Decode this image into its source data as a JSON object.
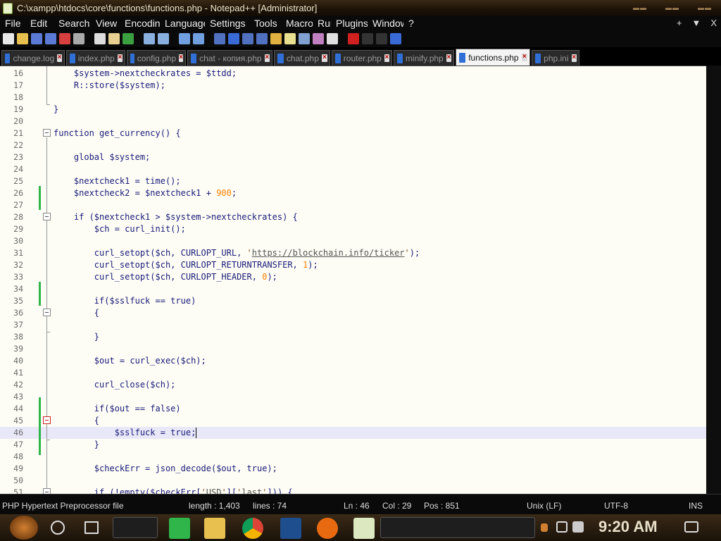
{
  "window": {
    "title": "C:\\xampp\\htdocs\\core\\functions\\functions.php - Notepad++ [Administrator]",
    "controls": [
      "minimize",
      "maximize",
      "close"
    ]
  },
  "menu": {
    "items": [
      "File",
      "Edit",
      "Search",
      "View",
      "Encoding",
      "Language",
      "Settings",
      "Tools",
      "Macro",
      "Run",
      "Plugins",
      "Window",
      "?"
    ],
    "right": [
      "+",
      "▼",
      "X"
    ]
  },
  "tabs": [
    {
      "label": "change.log",
      "active": false
    },
    {
      "label": "index.php",
      "active": false
    },
    {
      "label": "config.php",
      "active": false
    },
    {
      "label": "chat - копия.php",
      "active": false
    },
    {
      "label": "chat.php",
      "active": false
    },
    {
      "label": "router.php",
      "active": false
    },
    {
      "label": "minify.php",
      "active": false
    },
    {
      "label": "functions.php",
      "active": true
    },
    {
      "label": "php.ini",
      "active": false
    }
  ],
  "code": {
    "lines": [
      {
        "n": "16",
        "text": "    $system->nextcheckrates = $ttdd;"
      },
      {
        "n": "17",
        "text": "    R::store($system);"
      },
      {
        "n": "18",
        "text": ""
      },
      {
        "n": "19",
        "text": "}"
      },
      {
        "n": "20",
        "text": ""
      },
      {
        "n": "21",
        "text": "function get_currency() {"
      },
      {
        "n": "22",
        "text": ""
      },
      {
        "n": "23",
        "text": "    global $system;"
      },
      {
        "n": "24",
        "text": ""
      },
      {
        "n": "25",
        "text": "    $nextcheck1 = time();"
      },
      {
        "n": "26",
        "text": "    $nextcheck2 = $nextcheck1 + 900;"
      },
      {
        "n": "27",
        "text": ""
      },
      {
        "n": "28",
        "text": "    if ($nextcheck1 > $system->nextcheckrates) {"
      },
      {
        "n": "29",
        "text": "        $ch = curl_init();"
      },
      {
        "n": "30",
        "text": ""
      },
      {
        "n": "31",
        "text": "        curl_setopt($ch, CURLOPT_URL, 'https://blockchain.info/ticker');"
      },
      {
        "n": "32",
        "text": "        curl_setopt($ch, CURLOPT_RETURNTRANSFER, 1);"
      },
      {
        "n": "33",
        "text": "        curl_setopt($ch, CURLOPT_HEADER, 0);"
      },
      {
        "n": "34",
        "text": ""
      },
      {
        "n": "35",
        "text": "        if($sslfuck == true)"
      },
      {
        "n": "36",
        "text": "        {"
      },
      {
        "n": "37",
        "text": ""
      },
      {
        "n": "38",
        "text": "        }"
      },
      {
        "n": "39",
        "text": ""
      },
      {
        "n": "40",
        "text": "        $out = curl_exec($ch);"
      },
      {
        "n": "41",
        "text": ""
      },
      {
        "n": "42",
        "text": "        curl_close($ch);"
      },
      {
        "n": "43",
        "text": ""
      },
      {
        "n": "44",
        "text": "        if($out == false)"
      },
      {
        "n": "45",
        "text": "        {"
      },
      {
        "n": "46",
        "text": "            $sslfuck = true;"
      },
      {
        "n": "47",
        "text": "        }"
      },
      {
        "n": "48",
        "text": ""
      },
      {
        "n": "49",
        "text": "        $checkErr = json_decode($out, true);"
      },
      {
        "n": "50",
        "text": ""
      },
      {
        "n": "51",
        "text": "        if (!empty($checkErr['USD']['last'])) {"
      }
    ],
    "current_line": "46"
  },
  "status": {
    "file_type": "PHP Hypertext Preprocessor file",
    "length": "length : 1,403",
    "lines": "lines : 74",
    "ln": "Ln : 46",
    "col": "Col : 29",
    "pos": "Pos : 851",
    "eol": "Unix (LF)",
    "encoding": "UTF-8",
    "mode": "INS"
  },
  "taskbar": {
    "clock": "9:20 AM"
  },
  "colors": {
    "change_bar": "#2fb54a",
    "editor_bg": "#fdfdf5",
    "current_line": "#e8e8f8"
  }
}
